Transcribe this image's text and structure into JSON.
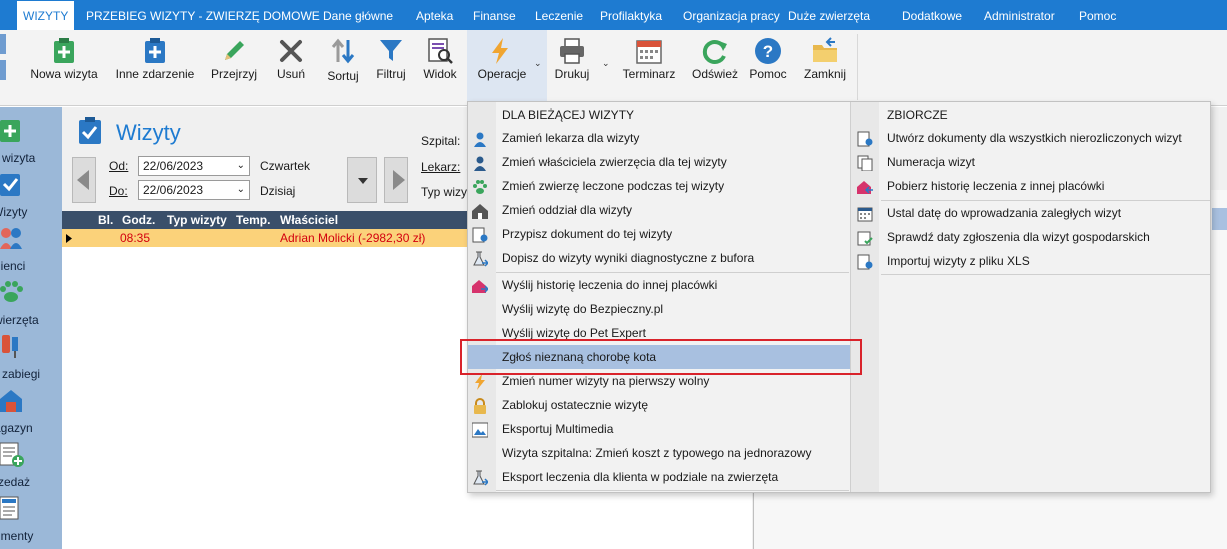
{
  "menu": {
    "tabs": [
      "WIZYTY",
      "PRZEBIEG WIZYTY - ZWIERZĘ DOMOWE",
      "Dane główne",
      "Apteka",
      "Finanse",
      "Leczenie",
      "Profilaktyka",
      "Organizacja pracy",
      "Duże zwierzęta",
      "Dodatkowe",
      "Administrator",
      "Pomoc"
    ]
  },
  "ribbon": {
    "buttons": {
      "nowa_wizyta": "Nowa wizyta",
      "inne_zdarzenie": "Inne zdarzenie",
      "przejrzyj": "Przejrzyj",
      "usun": "Usuń",
      "sortuj": "Sortuj",
      "filtruj": "Filtruj",
      "widok": "Widok",
      "operacje": "Operacje",
      "drukuj": "Drukuj",
      "terminarz": "Terminarz",
      "odswiez": "Odśwież",
      "pomoc": "Pomoc",
      "zamknij": "Zamknij"
    }
  },
  "leftnav": {
    "items": [
      "a wizyta",
      "Wizyty",
      "lienci",
      "wierzęta",
      "i zabiegi",
      "agazyn",
      "rzedaż",
      "umenty"
    ]
  },
  "main": {
    "title": "Wizyty",
    "od_label": "Od:",
    "do_label": "Do:",
    "od_value": "22/06/2023",
    "do_value": "22/06/2023",
    "od_day": "Czwartek",
    "do_day": "Dzisiaj",
    "szpital_label": "Szpital:",
    "lekarz_label": "Lekarz:",
    "typ_label": "Typ wizyt",
    "grid": {
      "headers": [
        "Bl.",
        "Godz.",
        "Typ wizyty",
        "Temp.",
        "Właściciel"
      ],
      "rows": [
        {
          "godz": "08:35",
          "wlasciciel": "Adrian Molicki (-2982,30 zł)"
        }
      ]
    }
  },
  "dropdown": {
    "left_header": "DLA BIEŻĄCEJ WIZYTY",
    "left_items": [
      "Zamień lekarza dla wizyty",
      "Zmień właściciela zwierzęcia dla tej wizyty",
      "Zmień zwierzę leczone podczas tej wizyty",
      "Zmień oddział dla wizyty",
      "Przypisz dokument do tej wizyty",
      "Dopisz do wizyty wyniki diagnostyczne z bufora",
      "Wyślij historię leczenia do innej placówki",
      "Wyślij wizytę do Bezpieczny.pl",
      "Wyślij wizytę do Pet Expert",
      "Zgłoś nieznaną chorobę kota",
      "Zmień numer wizyty na pierwszy wolny",
      "Zablokuj ostatecznie wizytę",
      "Eksportuj Multimedia",
      "Wizyta szpitalna: Zmień koszt z typowego na jednorazowy",
      "Eksport leczenia dla klienta w podziale na zwierzęta"
    ],
    "right_header": "ZBIORCZE",
    "right_items": [
      "Utwórz dokumenty dla wszystkich nierozliczonych wizyt",
      "Numeracja wizyt",
      "Pobierz historię leczenia z innej placówki",
      "Ustal datę do wprowadzania zaległych wizyt",
      "Sprawdź daty zgłoszenia dla wizyt gospodarskich",
      "Importuj wizyty z pliku XLS"
    ]
  },
  "colors": {
    "accent": "#1e7bd1",
    "selection": "#a8c0e0",
    "highlight_border": "#d9232b",
    "row_highlight": "#fbd27a",
    "row_text": "#d3000e"
  }
}
